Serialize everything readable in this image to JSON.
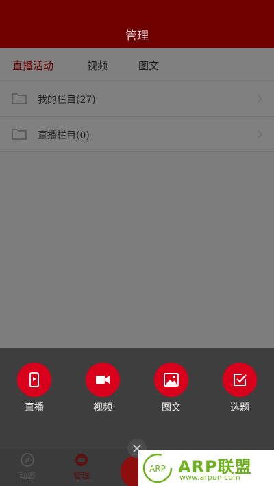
{
  "header": {
    "title": "管理"
  },
  "tabs": [
    {
      "label": "直播活动",
      "active": true
    },
    {
      "label": "视频",
      "active": false
    },
    {
      "label": "图文",
      "active": false
    }
  ],
  "list": [
    {
      "label": "我的栏目(27)",
      "icon": "folder-icon"
    },
    {
      "label": "直播栏目(0)",
      "icon": "folder-icon"
    }
  ],
  "actions": [
    {
      "label": "直播",
      "icon": "phone-live-icon"
    },
    {
      "label": "视频",
      "icon": "video-camera-icon"
    },
    {
      "label": "图文",
      "icon": "image-icon"
    },
    {
      "label": "选题",
      "icon": "checkbox-icon"
    }
  ],
  "bottom_nav": [
    {
      "label": "动态",
      "icon": "compass-icon"
    },
    {
      "label": "管理",
      "icon": "manage-icon",
      "active": true
    }
  ],
  "watermark": {
    "badge": "ARP",
    "brand": "ARP联盟",
    "url": "www.arpun.com"
  },
  "colors": {
    "header": "#6e0000",
    "accent": "#d9001b",
    "overlay": "#7d7d7d",
    "sheet": "#3e3e3e"
  }
}
